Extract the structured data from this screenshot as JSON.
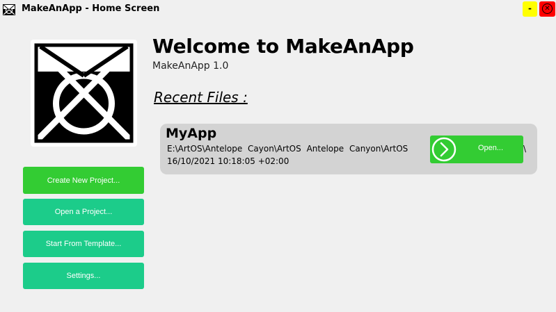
{
  "window": {
    "title": "MakeAnApp - Home Screen",
    "icon": "app-logo-icon",
    "minimize_label": "-",
    "close_icon": "close-circle-icon"
  },
  "logo": {
    "icon": "app-logo"
  },
  "header": {
    "welcome": "Welcome to MakeAnApp",
    "version": "MakeAnApp 1.0",
    "recent_title": "Recent Files :"
  },
  "sidebar": {
    "buttons": [
      {
        "label": "Create New Project...",
        "color": "#33cc33"
      },
      {
        "label": "Open a Project...",
        "color": "#1ccc8a"
      },
      {
        "label": "Start From Template...",
        "color": "#1ccc8a"
      },
      {
        "label": "Settings...",
        "color": "#1ccc8a"
      }
    ]
  },
  "recent_files": [
    {
      "name": "MyApp",
      "path": "E:\\ArtOS\\Antelope Cayon\\ArtOS Antelope Canyon\\ArtOS",
      "path_tail": "\\",
      "date": "16/10/2021 10:18:05 +02:00",
      "open_label": "Open...",
      "open_icon": "chevron-right-circle-icon"
    }
  ],
  "colors": {
    "background": "#f0f0f0",
    "card": "#d3d3d3",
    "primary_green": "#33cc33",
    "teal": "#1ccc8a",
    "minimize": "#ffff00",
    "close": "#ff0000"
  }
}
